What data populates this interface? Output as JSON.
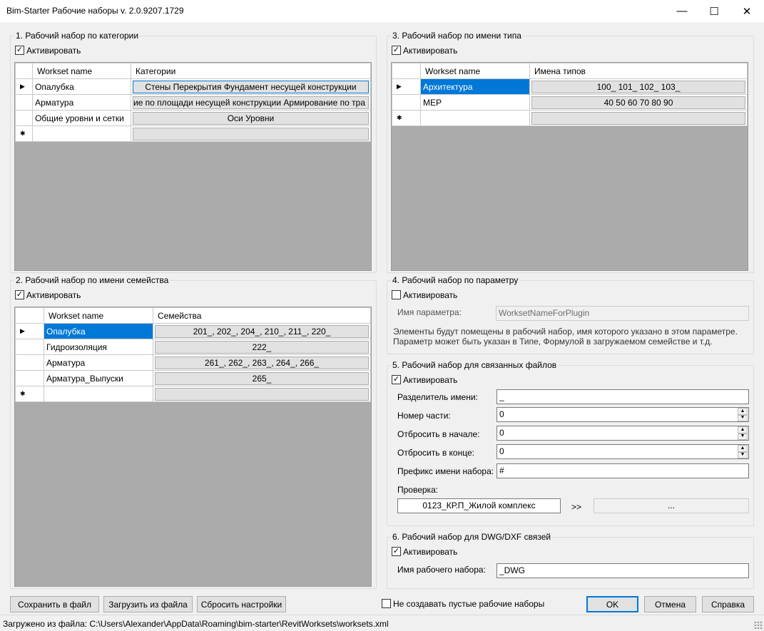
{
  "window": {
    "title": "Bim-Starter Рабочие наборы v. 2.0.9207.1729",
    "minimize": "—",
    "maximize": "☐",
    "close": "✕"
  },
  "group1": {
    "title": "1. Рабочий набор по категории",
    "activate_label": "Активировать",
    "activate_checked": true,
    "columns": [
      "Workset name",
      "Категории"
    ],
    "rows": [
      {
        "name": "Опалубка",
        "value": "Стены Перекрытия Фундамент несущей конструкции"
      },
      {
        "name": "Арматура",
        "value": "ие по площади несущей конструкции Армирование по тра"
      },
      {
        "name": "Общие уровни и сетки",
        "value": "Оси Уровни"
      }
    ]
  },
  "group2": {
    "title": "2. Рабочий набор по имени семейства",
    "activate_label": "Активировать",
    "activate_checked": true,
    "columns": [
      "Workset name",
      "Семейства"
    ],
    "rows": [
      {
        "name": "Опалубка",
        "value": "201_, 202_, 204_, 210_, 211_, 220_"
      },
      {
        "name": "Гидроизоляция",
        "value": "222_"
      },
      {
        "name": "Арматура",
        "value": "261_, 262_, 263_, 264_, 266_"
      },
      {
        "name": "Арматура_Выпуски",
        "value": "265_"
      }
    ]
  },
  "group3": {
    "title": "3. Рабочий набор по имени типа",
    "activate_label": "Активировать",
    "activate_checked": true,
    "columns": [
      "Workset name",
      "Имена типов"
    ],
    "rows": [
      {
        "name": "Архитектура",
        "value": "100_ 101_ 102_ 103_"
      },
      {
        "name": "MEP",
        "value": "40 50 60 70 80 90"
      }
    ]
  },
  "group4": {
    "title": "4. Рабочий набор по параметру",
    "activate_label": "Активировать",
    "activate_checked": false,
    "param_label": "Имя параметра:",
    "param_value": "WorksetNameForPlugin",
    "note_line1": "Элементы будут помещены в рабочий набор, имя которого указано в этом параметре.",
    "note_line2": "Параметр может быть указан в Типе, Формулой в загружаемом семействе и т.д."
  },
  "group5": {
    "title": "5. Рабочий набор для связанных файлов",
    "activate_label": "Активировать",
    "activate_checked": true,
    "separator_label": "Разделитель имени:",
    "separator_value": "_",
    "part_label": "Номер части:",
    "part_value": "0",
    "trim_start_label": "Отбросить в начале:",
    "trim_start_value": "0",
    "trim_end_label": "Отбросить в конце:",
    "trim_end_value": "0",
    "prefix_label": "Префикс имени набора:",
    "prefix_value": "#",
    "check_label": "Проверка:",
    "check_input": "0123_КР.П_Жилой комплекс",
    "arrow": ">>",
    "check_result": "..."
  },
  "group6": {
    "title": "6. Рабочий набор для DWG/DXF связей",
    "activate_label": "Активировать",
    "activate_checked": true,
    "name_label": "Имя рабочего набора:",
    "name_value": "_DWG"
  },
  "buttons": {
    "save": "Сохранить в файл",
    "load": "Загрузить из файла",
    "reset": "Сбросить настройки",
    "no_empty_label": "Не создавать пустые рабочие наборы",
    "ok": "OK",
    "cancel": "Отмена",
    "help": "Справка"
  },
  "grid_markers": {
    "current": "▶",
    "new": "✱"
  },
  "status": {
    "text": "Загружено из файла: C:\\Users\\Alexander\\AppData\\Roaming\\bim-starter\\RevitWorksets\\worksets.xml"
  }
}
